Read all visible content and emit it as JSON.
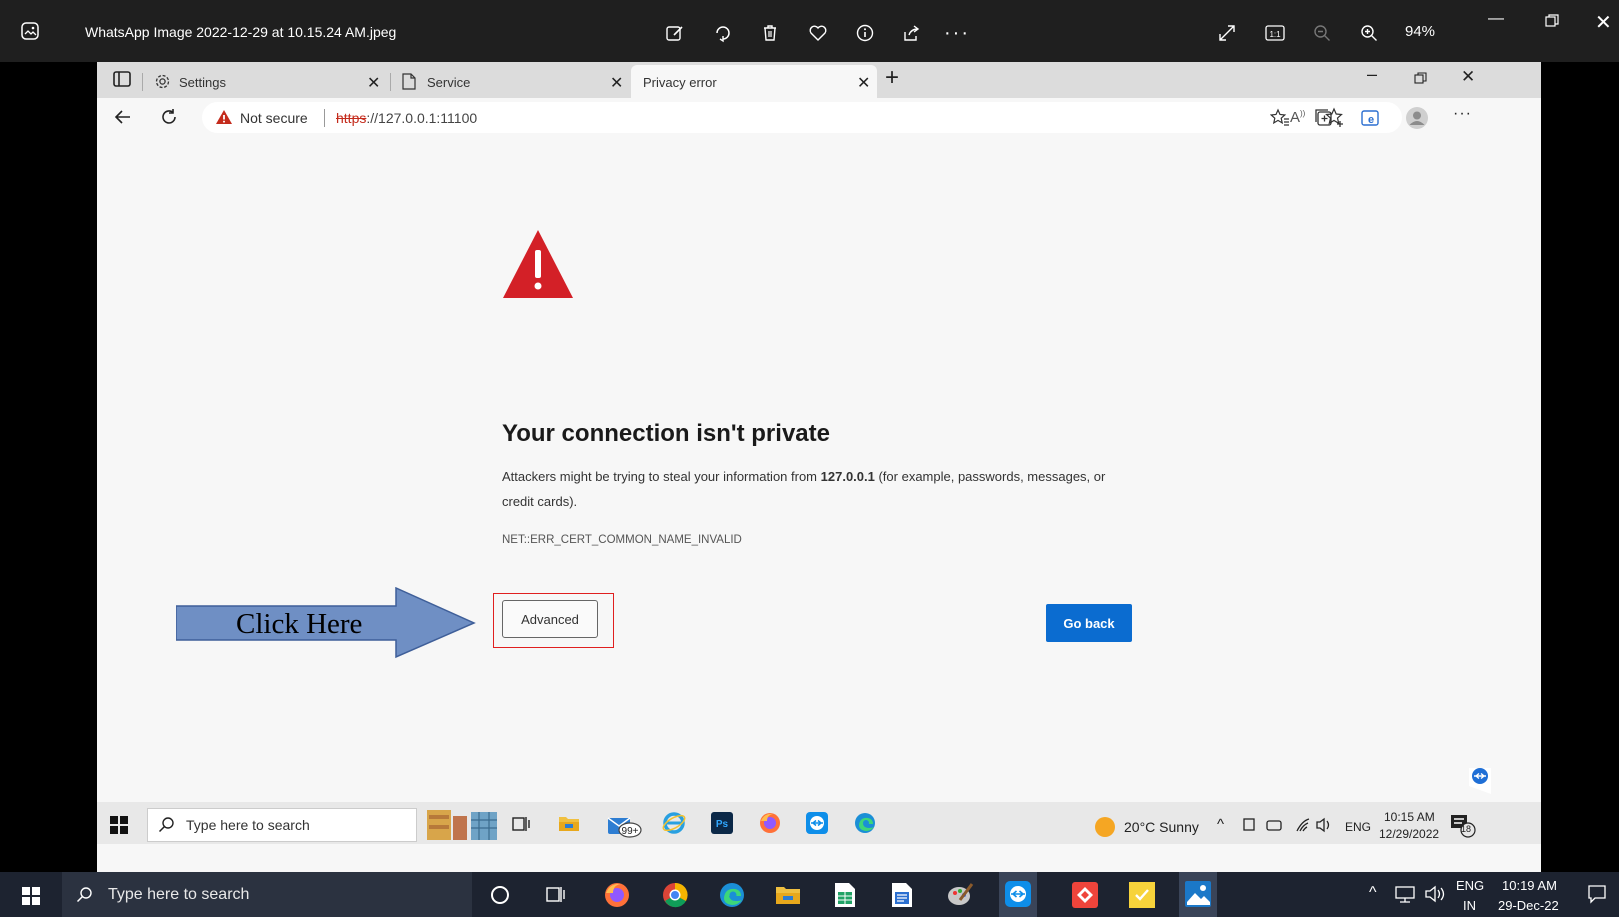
{
  "viewer": {
    "title": "WhatsApp Image 2022-12-29 at 10.15.24 AM.jpeg",
    "zoom": "94%",
    "icons": [
      "edit-image-icon",
      "rotate-icon",
      "delete-icon",
      "favorite-icon",
      "info-icon",
      "share-icon",
      "more-icon",
      "fullscreen-icon",
      "actual-size-icon",
      "zoom-out-icon",
      "zoom-in-icon"
    ]
  },
  "browser": {
    "tabs": [
      {
        "label": "Settings",
        "icon": "gear-icon",
        "active": false
      },
      {
        "label": "Service",
        "icon": "page-icon",
        "active": false
      },
      {
        "label": "Privacy error",
        "icon": "none",
        "active": true
      }
    ],
    "address": {
      "security_label": "Not secure",
      "scheme": "https",
      "host": "://127.0.0.1:11100"
    }
  },
  "error_page": {
    "title": "Your connection isn't private",
    "desc_pre": "Attackers might be trying to steal your information from ",
    "desc_host": "127.0.0.1",
    "desc_post": " (for example, passwords, messages, or credit cards).",
    "error_code": "NET::ERR_CERT_COMMON_NAME_INVALID",
    "advanced_label": "Advanced",
    "goback_label": "Go back",
    "accent_color": "#0b6cd0",
    "warning_color": "#d32027"
  },
  "callout": {
    "label": "Click Here",
    "arrow_color": "#6f8fc4"
  },
  "inner_taskbar": {
    "search_placeholder": "Type here to search",
    "weather": "20°C  Sunny",
    "lang": "ENG",
    "time": "10:15 AM",
    "date": "12/29/2022",
    "notif_count": "18",
    "badge": "99+"
  },
  "outer_taskbar": {
    "search_placeholder": "Type here to search",
    "lang_top": "ENG",
    "lang_bottom": "IN",
    "time": "10:19 AM",
    "date": "29-Dec-22"
  }
}
